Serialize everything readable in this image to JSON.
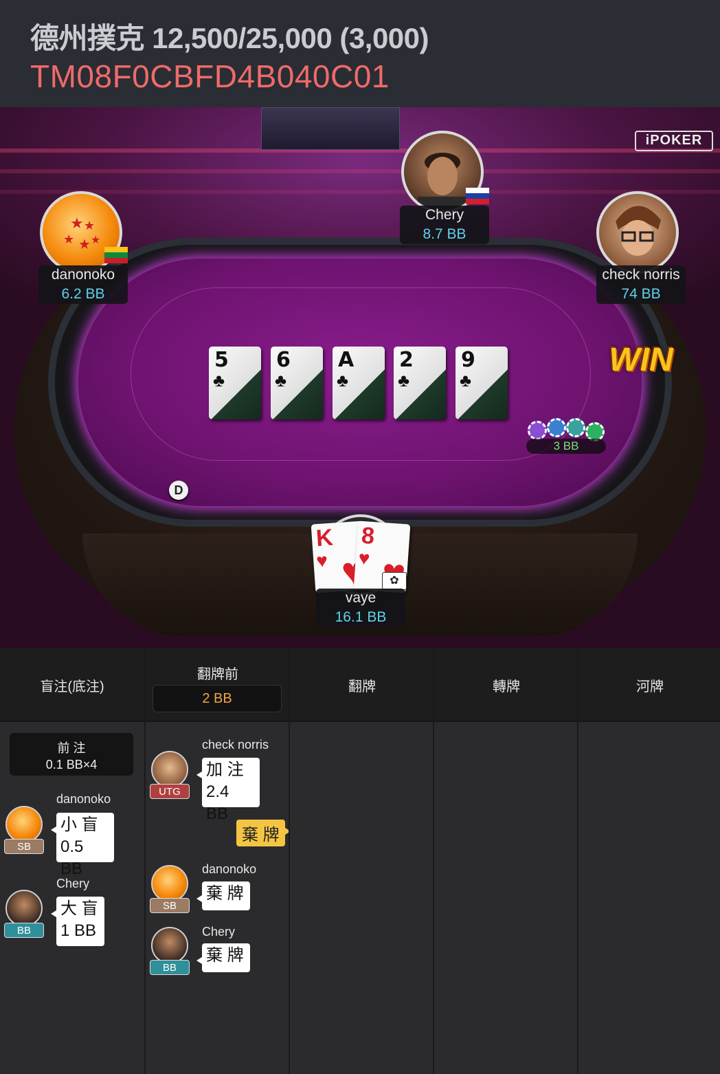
{
  "header": {
    "title": "德州撲克 12,500/25,000 (3,000)",
    "hand_id": "TM08F0CBFD4B040C01"
  },
  "brand": "iPOKER",
  "players": {
    "danonoko": {
      "name": "danonoko",
      "stack": "6.2 BB",
      "flag": "Lithuania"
    },
    "chery": {
      "name": "Chery",
      "stack": "8.7 BB",
      "flag": "Russia"
    },
    "check_norris": {
      "name": "check norris",
      "stack": "74 BB",
      "badge": "WIN"
    },
    "vaye": {
      "name": "vaye",
      "stack": "16.1 BB"
    }
  },
  "board": [
    {
      "rank": "5",
      "suit": "♣"
    },
    {
      "rank": "6",
      "suit": "♣"
    },
    {
      "rank": "A",
      "suit": "♣"
    },
    {
      "rank": "2",
      "suit": "♣"
    },
    {
      "rank": "9",
      "suit": "♣"
    }
  ],
  "hero_cards": [
    {
      "rank": "K",
      "suit": "♥"
    },
    {
      "rank": "8",
      "suit": "♥"
    }
  ],
  "pot": "3 BB",
  "dealer_button": "D",
  "history": {
    "columns": [
      "盲注(底注)",
      "翻牌前",
      "翻牌",
      "轉牌",
      "河牌"
    ],
    "preflop_pot": "2 BB",
    "ante": {
      "label": "前 注",
      "value": "0.1 BB×4"
    },
    "blinds": [
      {
        "name": "danonoko",
        "pos": "SB",
        "action": "小 盲",
        "amount": "0.5 BB"
      },
      {
        "name": "Chery",
        "pos": "BB",
        "action": "大 盲",
        "amount": "1 BB"
      }
    ],
    "preflop": [
      {
        "name": "check norris",
        "pos": "UTG",
        "action": "加 注",
        "amount": "2.4 BB"
      },
      {
        "hero_action": "棄 牌"
      },
      {
        "name": "danonoko",
        "pos": "SB",
        "action": "棄 牌"
      },
      {
        "name": "Chery",
        "pos": "BB",
        "action": "棄 牌"
      }
    ]
  }
}
